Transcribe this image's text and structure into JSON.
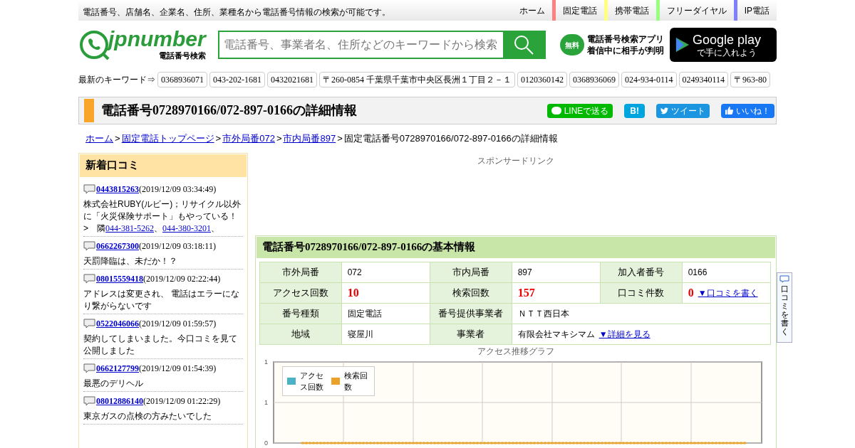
{
  "top_bar": {
    "tagline": "電話番号、店舗名、企業名、住所、業種名から電話番号情報の検索が可能です。",
    "nav": [
      {
        "label": "ホーム"
      },
      {
        "label": "固定電話",
        "color": "#ff8080"
      },
      {
        "label": "携帯電話",
        "color": "#ffff80"
      },
      {
        "label": "フリーダイヤル",
        "color": "#99ff80"
      },
      {
        "label": "IP電話",
        "color": "#8080ff"
      }
    ]
  },
  "header": {
    "logo": "jpnumber",
    "logo_sub": "電話番号検索",
    "search": {
      "placeholder": "電話番号、事業者名、住所などのキーワードから検索"
    },
    "app_badge": "無料",
    "app_line1": "電話番号検索アプリ",
    "app_line2": "着信中に相手が判明",
    "store_title": "Google play",
    "store_sub": "で手に入れよう"
  },
  "keywords": {
    "label": "最新のキーワード⇒",
    "items": [
      "0368936071",
      "043-202-1681",
      "0432021681",
      "〒260-0854 千葉県千葉市中央区長洲１丁目２－１",
      "0120360142",
      "0368936069",
      "024-934-0114",
      "0249340114",
      "〒963-80"
    ]
  },
  "title_bar": {
    "title": "電話番号0728970166/072-897-0166の詳細情報",
    "share": [
      {
        "kind": "line",
        "label": "LINEで送る"
      },
      {
        "kind": "hatena",
        "label": "B!"
      },
      {
        "kind": "tweet",
        "label": "ツイート"
      },
      {
        "kind": "like",
        "label": "いいね！"
      }
    ]
  },
  "breadcrumb": [
    {
      "kind": "link",
      "label": "ホーム"
    },
    {
      "kind": "separator",
      "label": ">"
    },
    {
      "kind": "link",
      "label": "固定電話トップページ"
    },
    {
      "kind": "separator",
      "label": ">"
    },
    {
      "kind": "link",
      "label": "市外局番072"
    },
    {
      "kind": "separator",
      "label": ">"
    },
    {
      "kind": "link",
      "label": "市内局番897"
    },
    {
      "kind": "separator",
      "label": ">"
    },
    {
      "kind": "current",
      "label": "固定電話番号0728970166/072-897-0166の詳細情報"
    }
  ],
  "sidebar": {
    "title": "新着口コミ",
    "comments": [
      {
        "number": "0443815263",
        "date": "(2019/12/09 03:34:49)",
        "text": [
          {
            "kind": "text",
            "t": "株式会社RUBY(ルビー)；リサイクル以外に「火災保険サポート」もやっている！　>　隣"
          },
          {
            "kind": "link",
            "t": "044-381-5262"
          },
          {
            "kind": "text",
            "t": "、"
          },
          {
            "kind": "link",
            "t": "044-380-3201"
          },
          {
            "kind": "text",
            "t": "、"
          }
        ]
      },
      {
        "number": "0662267300",
        "date": "(2019/12/09 03:18:11)",
        "text": [
          {
            "kind": "text",
            "t": "天罰降臨は、未だか！？"
          }
        ]
      },
      {
        "number": "08015559418",
        "date": "(2019/12/09 02:22:44)",
        "text": [
          {
            "kind": "text",
            "t": "アドレスは変更され、 電話はエラーになり繋がらないです"
          }
        ]
      },
      {
        "number": "0522046066",
        "date": "(2019/12/09 01:59:57)",
        "text": [
          {
            "kind": "text",
            "t": "契約してしまいました。今口コミを見て公開しました"
          }
        ]
      },
      {
        "number": "0662127799",
        "date": "(2019/12/09 01:54:39)",
        "text": [
          {
            "kind": "text",
            "t": "最悪のデリヘル"
          }
        ]
      },
      {
        "number": "08012886140",
        "date": "(2019/12/09 01:22:29)",
        "text": [
          {
            "kind": "text",
            "t": "東京ガスの点検の方みたいでした"
          }
        ]
      }
    ]
  },
  "sponsor": "スポンサードリンク",
  "basic_info": {
    "title": "電話番号0728970166/072-897-0166の基本情報",
    "rows": [
      [
        {
          "label": "市外局番",
          "value": "072",
          "kind": "plain"
        },
        {
          "label": "市内局番",
          "value": "897",
          "kind": "plain"
        },
        {
          "label": "加入者番号",
          "value": "0166",
          "kind": "plain"
        }
      ],
      [
        {
          "label": "アクセス回数",
          "value": "10",
          "kind": "count"
        },
        {
          "label": "検索回数",
          "value": "157",
          "kind": "count"
        },
        {
          "label": "口コミ件数",
          "value": "0",
          "kind": "count",
          "link": "▼口コミを書く"
        }
      ],
      [
        {
          "label": "番号種類",
          "value": "固定電話",
          "kind": "plain"
        },
        {
          "label": "番号提供事業者",
          "value": "ＮＴＴ西日本",
          "kind": "wide"
        }
      ],
      [
        {
          "label": "地域",
          "value": "寝屋川",
          "kind": "plain"
        },
        {
          "label": "事業者",
          "value": "有限会社マキシマム",
          "kind": "wide",
          "link": "▼詳細を見る"
        }
      ]
    ]
  },
  "chart": {
    "chart_data": {
      "type": "line",
      "title": "アクセス推移グラフ",
      "grid": true,
      "legend": true,
      "yticks": [
        {
          "value": 0,
          "label": "0"
        },
        {
          "value": 0.5,
          "label": "1"
        },
        {
          "value": 1,
          "label": "1"
        }
      ],
      "ylim": [
        0,
        1
      ],
      "series": [
        {
          "name": "アクセス回数",
          "color": "#4bb2c5",
          "values": [
            null,
            null,
            null,
            null,
            null,
            null,
            null,
            null,
            null,
            null,
            null,
            null,
            null,
            null,
            null,
            null,
            null,
            null,
            null,
            null,
            null,
            null,
            null,
            null,
            null,
            null,
            null,
            null,
            null,
            null,
            null,
            null,
            null,
            null,
            null,
            null,
            null,
            null,
            null,
            null,
            null,
            null,
            null,
            null,
            null,
            null,
            null,
            null,
            null,
            null,
            null,
            null,
            null,
            null,
            null,
            null,
            null,
            null,
            null,
            null
          ]
        },
        {
          "name": "検索回数",
          "color": "#eaa228",
          "line_style": "dotted",
          "values": [
            0,
            0,
            0,
            0,
            0,
            0,
            0,
            0,
            0,
            0,
            0,
            0,
            0,
            0,
            0,
            0,
            0,
            0,
            0,
            0,
            0,
            0,
            0,
            0,
            0,
            0,
            0,
            0,
            0,
            0,
            0,
            0,
            0,
            0,
            0,
            0,
            0,
            0,
            0,
            0,
            0,
            0,
            0,
            0,
            0,
            0,
            0,
            0,
            0,
            0,
            0,
            0,
            0,
            0,
            0,
            0,
            0,
            0,
            0,
            0
          ]
        }
      ]
    }
  },
  "side_tab": "口コミを書く"
}
